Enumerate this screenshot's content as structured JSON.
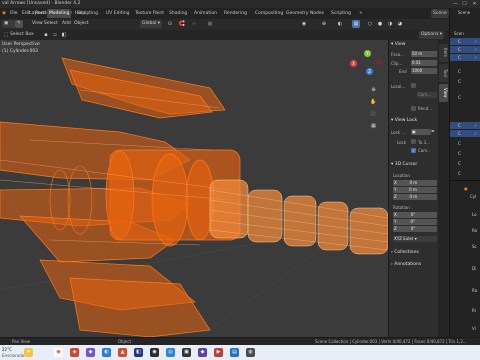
{
  "titlebar": {
    "title": "val Arrows [Unsaved] - Blender 4.2",
    "minimize": "—",
    "maximize": "☐",
    "close": "✕"
  },
  "menubar": {
    "items": [
      "File",
      "Edit",
      "Render",
      "Window",
      "Help"
    ],
    "workspaces": [
      "Layout",
      "Modeling",
      "Sculpting",
      "UV Editing",
      "Texture Paint",
      "Shading",
      "Animation",
      "Rendering",
      "Compositing",
      "Geometry Nodes",
      "Scripting"
    ],
    "active_workspace": "Modeling",
    "scene_label": "Scene"
  },
  "viewport_header": {
    "mode": "Edit Mode",
    "view": "View",
    "select": "Select",
    "add": "Add",
    "object": "Object",
    "orientation": "Global",
    "options": "Options",
    "select_box": "Select Box",
    "user_persp": "User Perspective",
    "object_name": "(1) Cylinder.003"
  },
  "npanel": {
    "tabs": [
      "Item",
      "Tool",
      "View"
    ],
    "active_tab": "View",
    "view_section": "View",
    "focal_label": "Foca...",
    "focal_value": "50 m",
    "clip_start_label": "Clip...",
    "clip_start_value": "0.01",
    "clip_end_label": "End",
    "clip_end_value": "1000",
    "local_label": "Local...",
    "local_value": "Cam...",
    "render_region": "Rend...",
    "view_lock_section": "View Lock",
    "lock_label": "Lock ...",
    "lock_to_label": "Lock",
    "lock_to_value": "To 3...",
    "lock_cam": "Cam...",
    "cursor_section": "3D Cursor",
    "location_label": "Location",
    "loc_x_label": "X",
    "loc_x_value": "0 m",
    "loc_y_label": "Y",
    "loc_y_value": "0 m",
    "loc_z_label": "Z",
    "loc_z_value": "0 m",
    "rotation_label": "Rotation",
    "rot_x_label": "X",
    "rot_x_value": "0°",
    "rot_y_label": "Y",
    "rot_y_value": "0°",
    "rot_z_label": "Z",
    "rot_z_value": "0°",
    "rot_mode": "XYZ Euler",
    "collections_section": "Collections",
    "annotations_section": "Annotations"
  },
  "right_panel": {
    "outliner_title": "Scene",
    "rows": [
      {
        "label": "Scen",
        "selected": false
      },
      {
        "label": "C",
        "selected": true
      },
      {
        "label": "C",
        "selected": true
      },
      {
        "label": "C",
        "selected": true
      },
      {
        "label": "C",
        "selected": false
      },
      {
        "label": "C",
        "selected": false
      },
      {
        "label": "C",
        "selected": false
      },
      {
        "label": "C",
        "selected": true
      },
      {
        "label": "C",
        "selected": true
      },
      {
        "label": "C",
        "selected": false
      },
      {
        "label": "C",
        "selected": false
      },
      {
        "label": "C",
        "selected": false
      },
      {
        "label": "C",
        "selected": false
      }
    ],
    "props_obj": "Cyl",
    "props_labels": [
      "Lo",
      "Ro",
      "Sc",
      "Di",
      "Ra",
      "Ri",
      "Vi"
    ]
  },
  "statusbar": {
    "left": "Pan View",
    "middle": "Object",
    "right": "Scene Collection | Cylinder.003 | Verts 0/40,472 | Faces 0/40,872 | Tris 1,2..."
  },
  "taskbar": {
    "weather": "22°C",
    "weather_sub": "Ensolarado"
  },
  "colors": {
    "wire_orange": "#ff7a1a",
    "fill_orange": "#e8620f",
    "selection_blue": "#4772b3",
    "outliner_selected": "#334d80"
  }
}
